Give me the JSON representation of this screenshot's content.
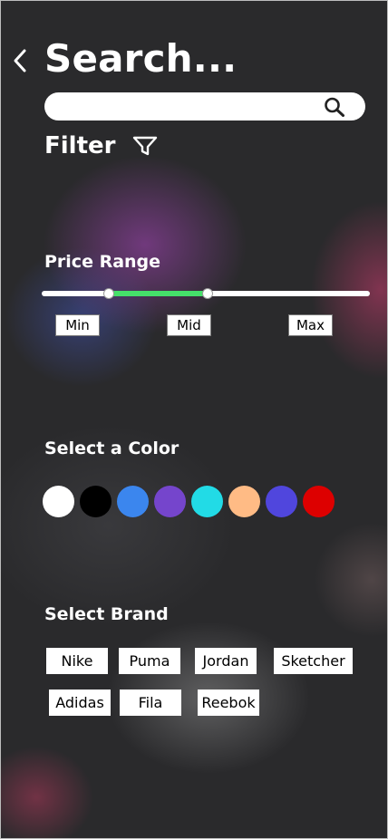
{
  "header": {
    "title": "Search..."
  },
  "search": {
    "value": "",
    "placeholder": ""
  },
  "filter": {
    "label": "Filter"
  },
  "price": {
    "label": "Price Range",
    "min_label": "Min",
    "mid_label": "Mid",
    "max_label": "Max",
    "range_low": 0.205,
    "range_high": 0.505,
    "fill_color": "#45e06a"
  },
  "color_section": {
    "label": "Select a Color",
    "swatches": [
      "#ffffff",
      "#000000",
      "#3b86ee",
      "#7545cc",
      "#22dbe6",
      "#ffbb85",
      "#5046dd",
      "#dd0000"
    ]
  },
  "brand_section": {
    "label": "Select Brand",
    "brands": [
      "Nike",
      "Puma",
      "Jordan",
      "Sketcher",
      "Adidas",
      "Fila",
      "Reebok"
    ]
  }
}
